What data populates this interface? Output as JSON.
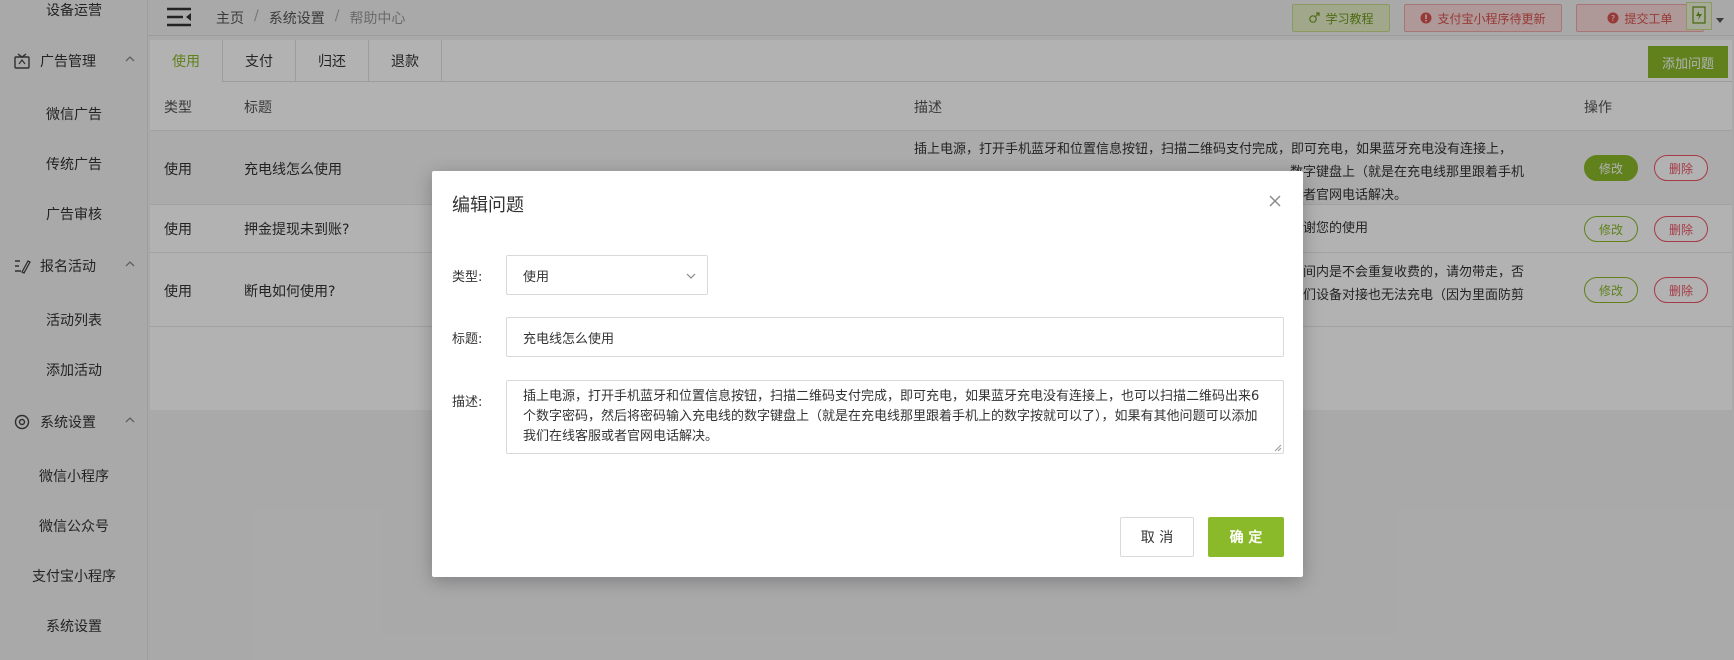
{
  "sidebar": {
    "top_item": "设备运营",
    "sections": [
      {
        "label": "广告管理",
        "icon": "ad-icon",
        "items": [
          "微信广告",
          "传统广告",
          "广告审核"
        ]
      },
      {
        "label": "报名活动",
        "icon": "edit-list-icon",
        "items": [
          "活动列表",
          "添加活动"
        ]
      },
      {
        "label": "系统设置",
        "icon": "gear-icon",
        "items": [
          "微信小程序",
          "微信公众号",
          "支付宝小程序",
          "系统设置"
        ]
      }
    ]
  },
  "topbar": {
    "breadcrumb": [
      "主页",
      "系统设置",
      "帮助中心"
    ],
    "separator": "/",
    "buttons": {
      "learn": "学习教程",
      "alipay_update": "支付宝小程序待更新",
      "ticket": "提交工单"
    }
  },
  "tabs": [
    "使用",
    "支付",
    "归还",
    "退款"
  ],
  "add_button": "添加问题",
  "table": {
    "headers": {
      "type": "类型",
      "title": "标题",
      "desc": "描述",
      "ops": "操作"
    },
    "rows": [
      {
        "type": "使用",
        "title": "充电线怎么使用",
        "desc_lines": [
          "插上电源，打开手机蓝牙和位置信息按钮，扫描二维码支付完成，即可充电，如果蓝牙充电没有连接上，",
          "数字键盘上（就是在充电线那里跟着手机",
          "或者官网电话解决。"
        ],
        "edit": "修改",
        "delete": "删除"
      },
      {
        "type": "使用",
        "title": "押金提现未到账?",
        "desc_lines": [
          "感谢您的使用"
        ],
        "edit": "修改",
        "delete": "删除"
      },
      {
        "type": "使用",
        "title": "断电如何使用?",
        "desc_lines": [
          "时间内是不会重复收费的，请勿带走，否",
          "我们设备对接也无法充电（因为里面防剪"
        ],
        "edit": "修改",
        "delete": "删除"
      }
    ]
  },
  "modal": {
    "title": "编辑问题",
    "type_label": "类型:",
    "type_value": "使用",
    "title_label": "标题:",
    "title_value": "充电线怎么使用",
    "desc_label": "描述:",
    "desc_value": "插上电源，打开手机蓝牙和位置信息按钮，扫描二维码支付完成，即可充电，如果蓝牙充电没有连接上，也可以扫描二维码出来6个数字密码，然后将密码输入充电线的数字键盘上（就是在充电线那里跟着手机上的数字按就可以了），如果有其他问题可以添加我们在线客服或者官网电话解决。",
    "cancel": "取 消",
    "confirm": "确 定"
  },
  "colors": {
    "accent": "#8ab929",
    "danger": "#ed5565",
    "overlay": "rgba(0,0,0,0.3)"
  }
}
